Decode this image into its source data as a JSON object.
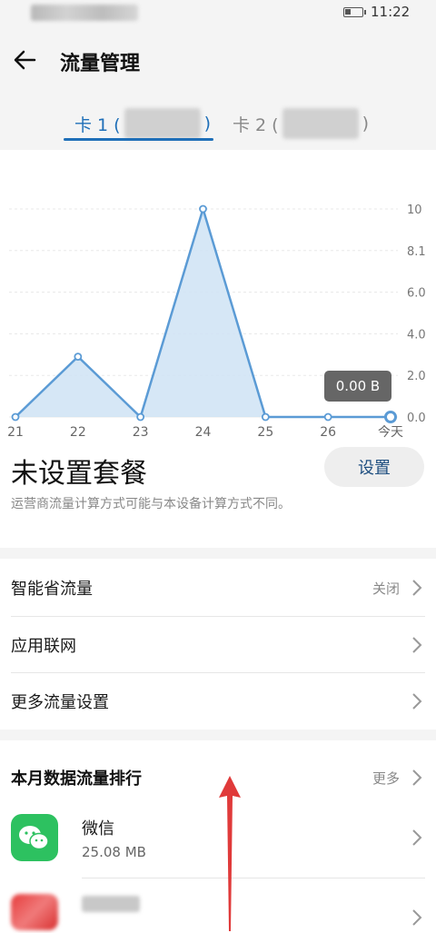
{
  "status_bar": {
    "time": "11:22"
  },
  "header": {
    "title": "流量管理"
  },
  "tabs": [
    {
      "prefix": "卡 1 (",
      "suffix": ")"
    },
    {
      "prefix": "卡 2 (",
      "suffix": ")"
    }
  ],
  "chart_data": {
    "type": "area",
    "categories": [
      "21",
      "22",
      "23",
      "24",
      "25",
      "26",
      "今天"
    ],
    "values": [
      0,
      2.9,
      0,
      10,
      0,
      0,
      0
    ],
    "y_ticks": [
      "10",
      "8.1",
      "6.0",
      "4.0",
      "2.0",
      "0.0"
    ],
    "ylim": [
      0,
      10
    ],
    "tooltip": "0.00 B",
    "grid": true,
    "colors": {
      "line": "#5b9bd5",
      "fill": "#cfe3f5",
      "point": "#5b9bd5",
      "tooltip_bg": "#666666"
    }
  },
  "plan": {
    "title": "未设置套餐",
    "button": "设置",
    "notice": "运营商流量计算方式可能与本设备计算方式不同。"
  },
  "settings": [
    {
      "label": "智能省流量",
      "value": "关闭"
    },
    {
      "label": "应用联网",
      "value": ""
    },
    {
      "label": "更多流量设置",
      "value": ""
    }
  ],
  "ranking": {
    "title": "本月数据流量排行",
    "more": "更多",
    "apps": [
      {
        "name": "微信",
        "usage": "25.08 MB"
      }
    ]
  },
  "colors": {
    "accent": "#1f6fb8",
    "wechat": "#2dc160",
    "arrow": "#e03a3a"
  }
}
